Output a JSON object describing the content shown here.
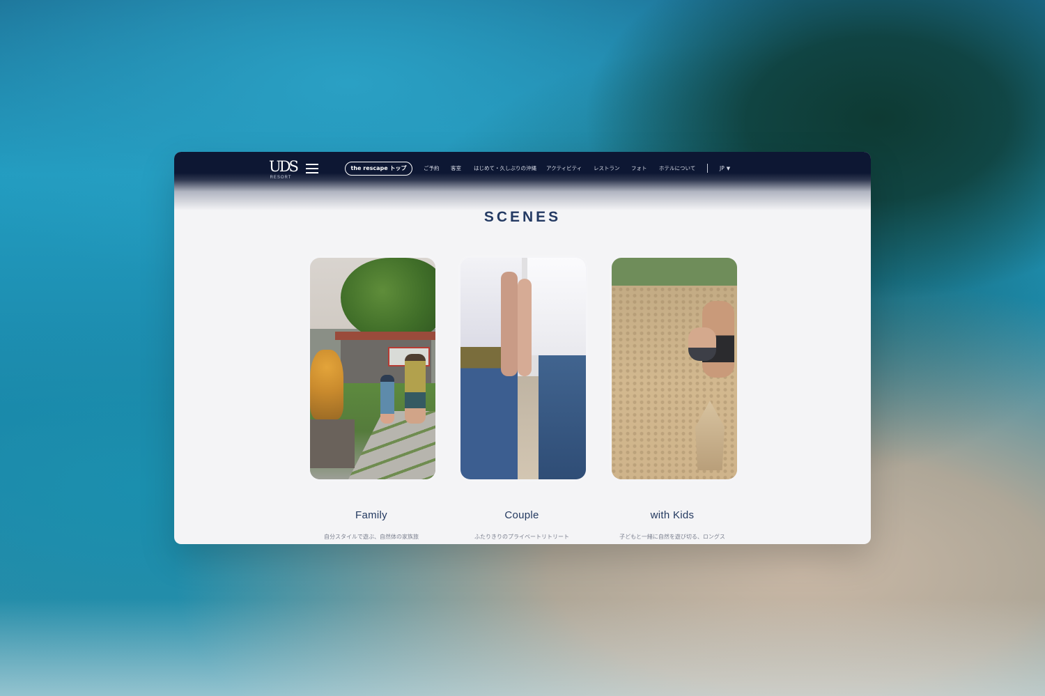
{
  "header": {
    "logo_mark": "UDS",
    "logo_sub": "RESORT",
    "top_button": "the rescape トップ",
    "menu": [
      "ご予約",
      "客室",
      "はじめて・久しぶりの沖縄",
      "アクティビティ",
      "レストラン",
      "フォト",
      "ホテルについて"
    ],
    "lang": "JP",
    "lang_caret": "▼"
  },
  "section_title": "SCENES",
  "cards": [
    {
      "label": "Family",
      "desc": "自分スタイルで遊ぶ、自然体の家族旅"
    },
    {
      "label": "Couple",
      "desc": "ふたりきりのプライベートリトリート"
    },
    {
      "label": "with Kids",
      "desc": "子どもと一緒に自然を遊び切る、ロングス"
    }
  ],
  "colors": {
    "header_navy": "#0d1733",
    "title_navy": "#243a63",
    "page_bg": "#f4f4f6"
  }
}
